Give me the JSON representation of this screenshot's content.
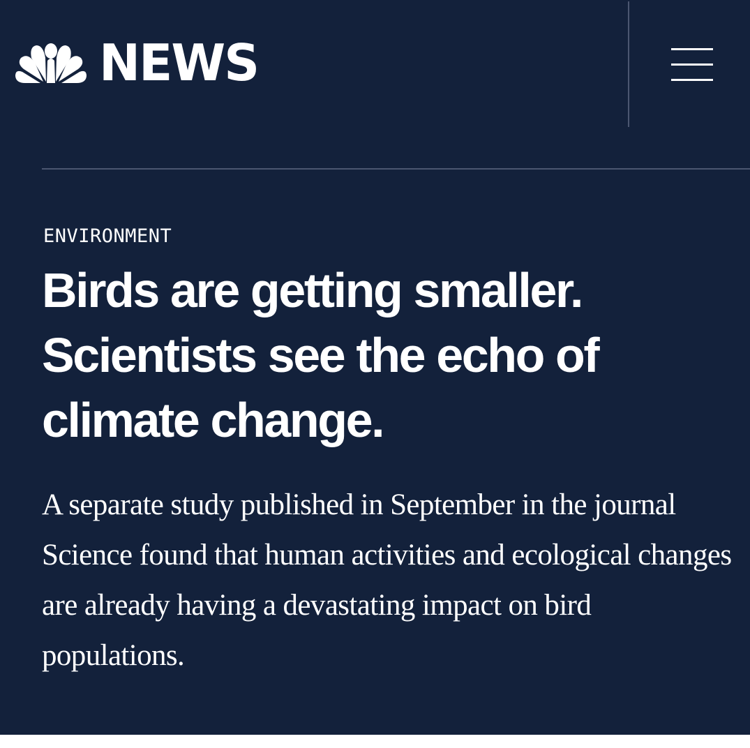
{
  "header": {
    "brand_text": "NEWS",
    "logo_icon": "nbc-peacock-icon",
    "menu_icon": "hamburger-menu-icon"
  },
  "article": {
    "category": "ENVIRONMENT",
    "headline": "Birds are getting smaller. Scientists see the echo of climate change.",
    "dek": "A separate study published in September in the journal Science found that human activities and ecological changes are already having a devastating impact on bird populations."
  },
  "colors": {
    "background": "#13213b",
    "text": "#ffffff",
    "divider": "#4b5670"
  }
}
